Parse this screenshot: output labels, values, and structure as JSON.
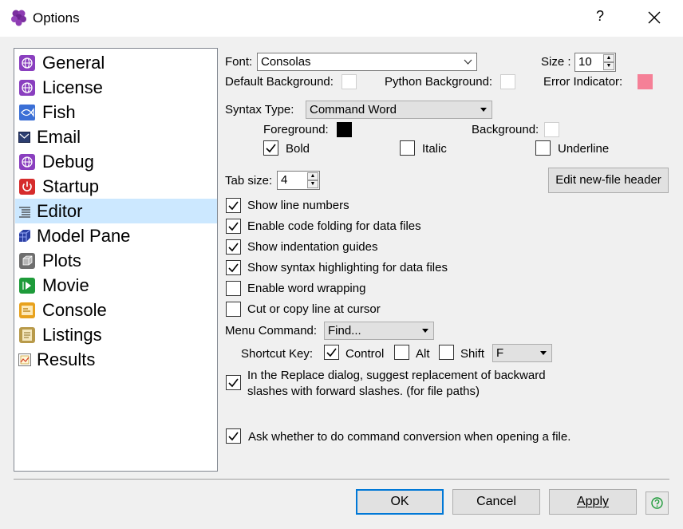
{
  "window": {
    "title": "Options",
    "help": "?",
    "close_icon": "close-icon"
  },
  "sidebar": {
    "items": [
      {
        "label": "General",
        "icon": "globe-icon"
      },
      {
        "label": "License",
        "icon": "globe-icon"
      },
      {
        "label": "Fish",
        "icon": "fish-icon"
      },
      {
        "label": "Email",
        "icon": "email-icon"
      },
      {
        "label": "Debug",
        "icon": "globe-icon"
      },
      {
        "label": "Startup",
        "icon": "power-icon"
      },
      {
        "label": "Editor",
        "icon": "editor-icon"
      },
      {
        "label": "Model Pane",
        "icon": "cube-icon"
      },
      {
        "label": "Plots",
        "icon": "box-icon"
      },
      {
        "label": "Movie",
        "icon": "movie-icon"
      },
      {
        "label": "Console",
        "icon": "console-icon"
      },
      {
        "label": "Listings",
        "icon": "listings-icon"
      },
      {
        "label": "Results",
        "icon": "results-icon"
      }
    ],
    "selected": "Editor"
  },
  "editor": {
    "font_label": "Font:",
    "font_value": "Consolas",
    "size_label": "Size :",
    "size_value": "10",
    "default_bg_label": "Default Background:",
    "python_bg_label": "Python Background:",
    "error_indicator_label": "Error Indicator:",
    "error_indicator_color": "#f58097",
    "syntax_type_label": "Syntax Type:",
    "syntax_type_value": "Command Word",
    "foreground_label": "Foreground:",
    "foreground_color": "#000000",
    "background_label": "Background:",
    "bold_label": "Bold",
    "bold_checked": true,
    "italic_label": "Italic",
    "italic_checked": false,
    "underline_label": "Underline",
    "underline_checked": false,
    "tab_size_label": "Tab size:",
    "tab_size_value": "4",
    "edit_header_label": "Edit new-file header",
    "options": [
      {
        "label": "Show line numbers",
        "checked": true
      },
      {
        "label": "Enable code folding for data files",
        "checked": true
      },
      {
        "label": "Show indentation guides",
        "checked": true
      },
      {
        "label": "Show syntax highlighting for data files",
        "checked": true
      },
      {
        "label": "Enable word wrapping",
        "checked": false
      },
      {
        "label": "Cut or copy line at cursor",
        "checked": false
      }
    ],
    "menu_command_label": "Menu Command:",
    "menu_command_value": "Find...",
    "shortcut_key_label": "Shortcut Key:",
    "control_label": "Control",
    "control_checked": true,
    "alt_label": "Alt",
    "alt_checked": false,
    "shift_label": "Shift",
    "shift_checked": false,
    "key_value": "F",
    "replace_line1": "In the Replace dialog, suggest replacement of backward",
    "replace_line2": "slashes with forward slashes. (for file paths)",
    "replace_checked": true,
    "ask_conversion_label": "Ask whether to do command conversion when opening a file.",
    "ask_conversion_checked": true
  },
  "footer": {
    "ok_label": "OK",
    "cancel_label": "Cancel",
    "apply_label": "Apply",
    "help_icon": "help-circle-icon"
  }
}
